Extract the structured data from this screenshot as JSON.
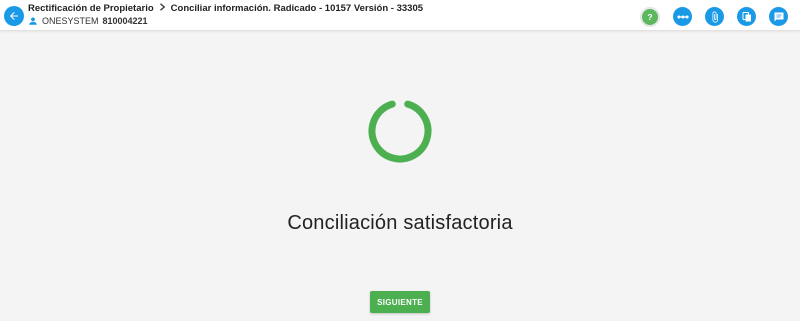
{
  "header": {
    "breadcrumb": {
      "parent": "Rectificación de Propietario",
      "current": "Conciliar información. Radicado - 10157 Versión - 33305"
    },
    "user": {
      "name": "ONESYSTEM",
      "id": "810004221"
    },
    "back_icon": "arrow-left-icon",
    "actions": [
      {
        "icon": "help-icon",
        "color": "#5cb85c"
      },
      {
        "icon": "more-horizontal-icon",
        "color": "#1a9ae6"
      },
      {
        "icon": "paperclip-icon",
        "color": "#1a9ae6"
      },
      {
        "icon": "copy-icon",
        "color": "#1a9ae6"
      },
      {
        "icon": "comment-icon",
        "color": "#1a9ae6"
      }
    ]
  },
  "main": {
    "message": "Conciliación satisfactoria",
    "next_button_label": "SIGUIENTE",
    "status_icon": "circular-progress-icon",
    "status_color": "#4caf50"
  }
}
